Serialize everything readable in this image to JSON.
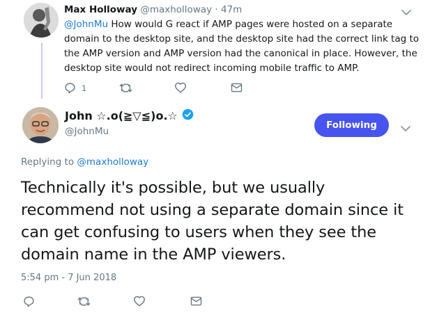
{
  "parent_tweet": {
    "name": "Max Holloway",
    "handle": "@maxholloway",
    "separator": " · ",
    "time": "47m",
    "mention": "@JohnMu",
    "text": " How would G react if AMP pages were hosted on a separate domain to the desktop site, and the desktop site had the correct link tag to the AMP version and AMP version had the canonical in place. However, the desktop site would not redirect incoming mobile traffic to AMP.",
    "reply_count": "1",
    "icons": [
      "reply-icon",
      "retweet-icon",
      "like-icon",
      "direct-message-icon"
    ]
  },
  "main_tweet": {
    "name": "John ☆.o(≧▽≦)o.☆",
    "handle": "@JohnMu",
    "follow_label": "Following",
    "replying_prefix": "Replying to ",
    "replying_to": "@maxholloway",
    "text": "Technically it's possible, but we usually recommend not using a separate domain since it can get confusing to users when they see the domain name in the AMP viewers.",
    "timestamp": "5:54 pm - 7 Jun 2018",
    "icons": [
      "reply-icon",
      "retweet-icon",
      "like-icon",
      "direct-message-icon"
    ]
  },
  "colors": {
    "accent": "#4754f0",
    "link": "#1b7bd4",
    "muted": "#657786",
    "verified": "#1da1f2"
  }
}
